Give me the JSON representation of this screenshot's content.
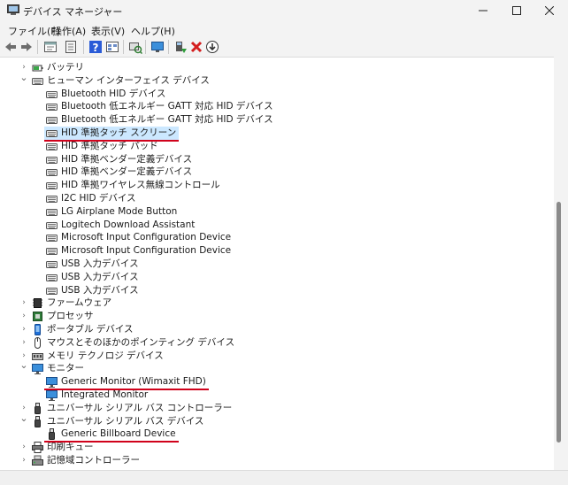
{
  "window": {
    "title": "デバイス マネージャー",
    "icon": "device-manager-icon"
  },
  "menu": [
    "ファイル(F)",
    "操作(A)",
    "表示(V)",
    "ヘルプ(H)"
  ],
  "toolbar": [
    "back-icon",
    "forward-icon",
    "properties-icon",
    "update-icon",
    "help-icon",
    "view-icon",
    "scan-icon",
    "monitor-icon",
    "add-driver-icon",
    "uninstall-icon",
    "download-icon"
  ],
  "tree": [
    {
      "label": "バッテリ",
      "level": 1,
      "expand": "collapsed",
      "icon": "battery-icon"
    },
    {
      "label": "ヒューマン インターフェイス デバイス",
      "level": 1,
      "expand": "expanded",
      "icon": "hid-icon"
    },
    {
      "label": "Bluetooth HID デバイス",
      "level": 2,
      "icon": "hid-icon"
    },
    {
      "label": "Bluetooth 低エネルギー GATT 対応 HID デバイス",
      "level": 2,
      "icon": "hid-icon"
    },
    {
      "label": "Bluetooth 低エネルギー GATT 対応 HID デバイス",
      "level": 2,
      "icon": "hid-icon"
    },
    {
      "label": "HID 準拠タッチ スクリーン",
      "level": 2,
      "icon": "hid-icon",
      "selected": true,
      "underline": true
    },
    {
      "label": "HID 準拠タッチ パッド",
      "level": 2,
      "icon": "hid-icon"
    },
    {
      "label": "HID 準拠ベンダー定義デバイス",
      "level": 2,
      "icon": "hid-icon"
    },
    {
      "label": "HID 準拠ベンダー定義デバイス",
      "level": 2,
      "icon": "hid-icon"
    },
    {
      "label": "HID 準拠ワイヤレス無線コントロール",
      "level": 2,
      "icon": "hid-icon"
    },
    {
      "label": "I2C HID デバイス",
      "level": 2,
      "icon": "hid-icon"
    },
    {
      "label": "LG Airplane Mode Button",
      "level": 2,
      "icon": "hid-icon"
    },
    {
      "label": "Logitech Download Assistant",
      "level": 2,
      "icon": "hid-icon"
    },
    {
      "label": "Microsoft Input Configuration Device",
      "level": 2,
      "icon": "hid-icon"
    },
    {
      "label": "Microsoft Input Configuration Device",
      "level": 2,
      "icon": "hid-icon"
    },
    {
      "label": "USB 入力デバイス",
      "level": 2,
      "icon": "hid-icon"
    },
    {
      "label": "USB 入力デバイス",
      "level": 2,
      "icon": "hid-icon"
    },
    {
      "label": "USB 入力デバイス",
      "level": 2,
      "icon": "hid-icon"
    },
    {
      "label": "ファームウェア",
      "level": 1,
      "expand": "collapsed",
      "icon": "firmware-icon"
    },
    {
      "label": "プロセッサ",
      "level": 1,
      "expand": "collapsed",
      "icon": "processor-icon"
    },
    {
      "label": "ポータブル デバイス",
      "level": 1,
      "expand": "collapsed",
      "icon": "portable-device-icon"
    },
    {
      "label": "マウスとそのほかのポインティング デバイス",
      "level": 1,
      "expand": "collapsed",
      "icon": "mouse-icon"
    },
    {
      "label": "メモリ テクノロジ デバイス",
      "level": 1,
      "expand": "collapsed",
      "icon": "memory-icon"
    },
    {
      "label": "モニター",
      "level": 1,
      "expand": "expanded",
      "icon": "monitor-icon"
    },
    {
      "label": "Generic Monitor (Wimaxit FHD)",
      "level": 2,
      "icon": "monitor-icon",
      "underline": true
    },
    {
      "label": "Integrated Monitor",
      "level": 2,
      "icon": "monitor-icon"
    },
    {
      "label": "ユニバーサル シリアル バス コントローラー",
      "level": 1,
      "expand": "collapsed",
      "icon": "usb-icon"
    },
    {
      "label": "ユニバーサル シリアル バス デバイス",
      "level": 1,
      "expand": "expanded",
      "icon": "usb-icon"
    },
    {
      "label": "Generic Billboard Device",
      "level": 2,
      "icon": "usb-icon",
      "underline": true
    },
    {
      "label": "印刷キュー",
      "level": 1,
      "expand": "collapsed",
      "icon": "printer-icon"
    },
    {
      "label": "記憶域コントローラー",
      "level": 1,
      "expand": "collapsed",
      "icon": "storage-icon"
    }
  ],
  "colors": {
    "selection": "#cce8ff",
    "underline": "#d0021b",
    "accent": "#1e6fd9"
  }
}
